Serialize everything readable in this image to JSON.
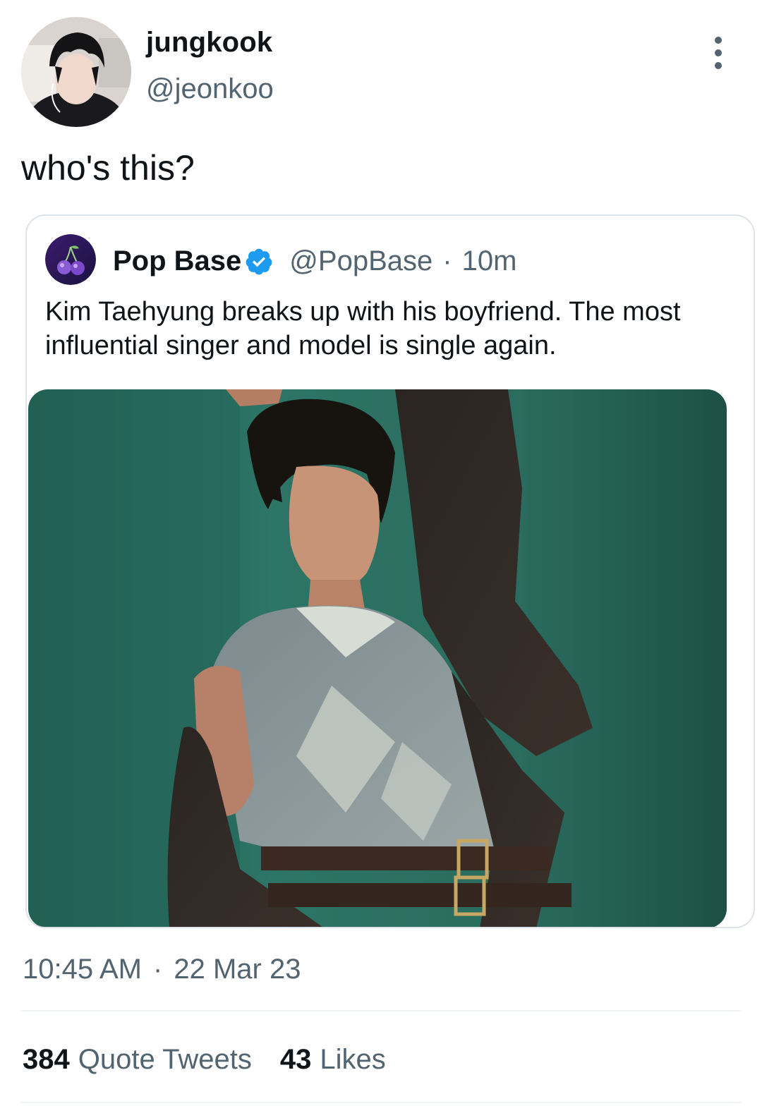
{
  "tweet": {
    "author_name": "jungkook",
    "author_handle": "@jeonkoo",
    "text": "who's this?",
    "time": "10:45 AM",
    "separator": "·",
    "date": "22 Mar 23"
  },
  "quoted_tweet": {
    "author_name": "Pop Base",
    "author_handle": "@PopBase",
    "separator": "·",
    "time_ago": "10m",
    "text": "Kim Taehyung breaks up with his boyfriend. The most influential singer and model is single again.",
    "verified": true
  },
  "stats": {
    "quote_tweets_count": "384",
    "quote_tweets_label": "Quote Tweets",
    "likes_count": "43",
    "likes_label": "Likes"
  },
  "colors": {
    "primary_text": "#0f1419",
    "secondary_text": "#536471",
    "verified_blue": "#1d9bf0",
    "border": "#dde3e8"
  },
  "icons": {
    "more": "more-vertical-icon",
    "verified": "verified-badge-icon"
  }
}
